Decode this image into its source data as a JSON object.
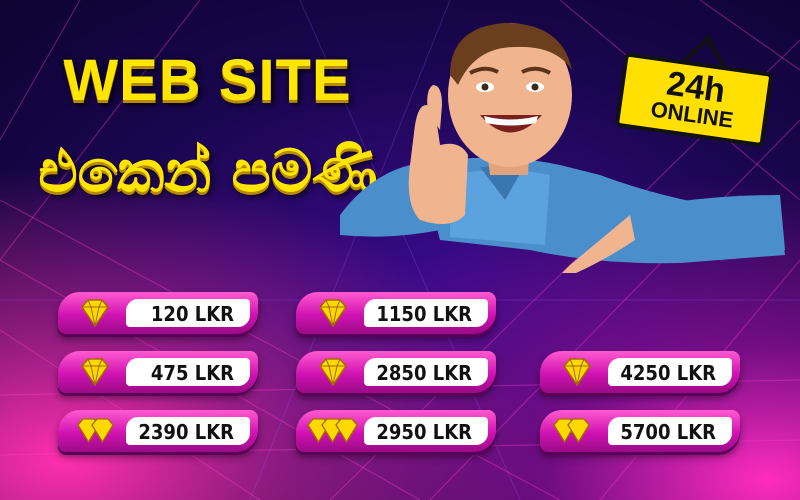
{
  "headline": "WEB SITE",
  "subline": "එකෙන් පමණි",
  "sign": {
    "main": "24h",
    "sub": "ONLINE"
  },
  "colors": {
    "accent_yellow": "#ffe600",
    "pill_pink": "#d012b2",
    "background": "#1a0650"
  },
  "price_buttons": [
    {
      "price": "120 LKR",
      "gems": 1,
      "icon": "diamond-icon"
    },
    {
      "price": "1150 LKR",
      "gems": 1,
      "icon": "diamond-icon"
    },
    {
      "price": "475 LKR",
      "gems": 1,
      "icon": "diamond-icon"
    },
    {
      "price": "2850 LKR",
      "gems": 1,
      "icon": "diamond-icon"
    },
    {
      "price": "4250 LKR",
      "gems": 1,
      "icon": "diamond-icon"
    },
    {
      "price": "2390 LKR",
      "gems": 2,
      "icon": "diamond-icon"
    },
    {
      "price": "2950 LKR",
      "gems": 3,
      "icon": "diamond-icon"
    },
    {
      "price": "5700 LKR",
      "gems": 2,
      "icon": "diamond-icon"
    }
  ]
}
